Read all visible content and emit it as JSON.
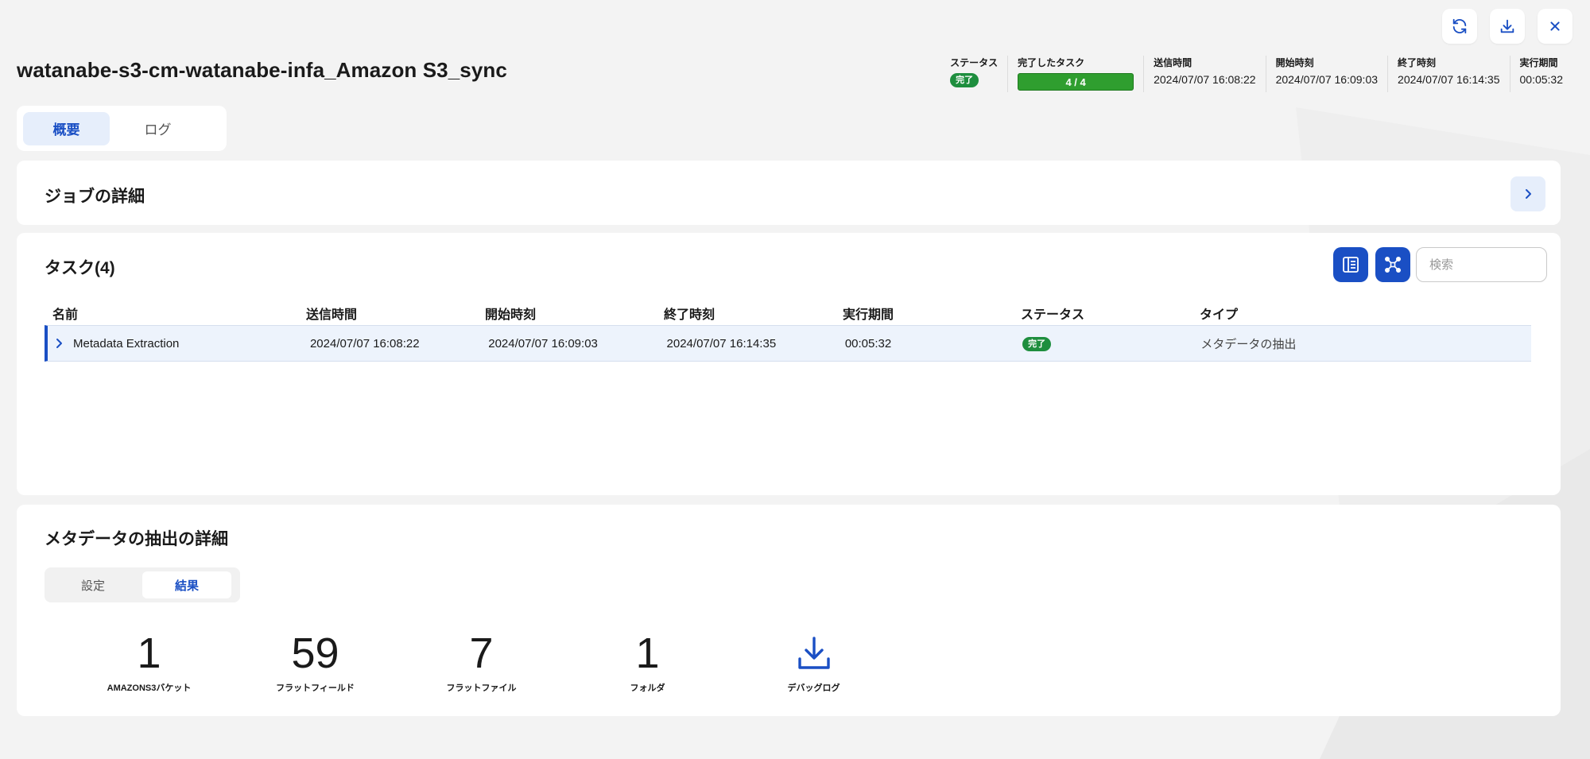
{
  "header": {
    "job_title": "watanabe-s3-cm-watanabe-infa_Amazon S3_sync"
  },
  "actions": {
    "refresh_icon": "refresh-icon",
    "download_icon": "download-icon",
    "close_icon": "close-icon"
  },
  "summary": {
    "status_label": "ステータス",
    "status_value": "完了",
    "tasks_label": "完了したタスク",
    "tasks_value": "4 / 4",
    "tasks_progress": 1.0,
    "submitted_label": "送信時間",
    "submitted_value": "2024/07/07 16:08:22",
    "start_label": "開始時刻",
    "start_value": "2024/07/07 16:09:03",
    "end_label": "終了時刻",
    "end_value": "2024/07/07 16:14:35",
    "duration_label": "実行期間",
    "duration_value": "00:05:32"
  },
  "main_tabs": [
    {
      "label": "概要",
      "active": true
    },
    {
      "label": "ログ",
      "active": false
    }
  ],
  "job_details": {
    "title": "ジョブの詳細"
  },
  "tasks": {
    "title": "タスク(4)",
    "search_placeholder": "検索",
    "columns": [
      "名前",
      "送信時間",
      "開始時刻",
      "終了時刻",
      "実行期間",
      "ステータス",
      "タイプ"
    ],
    "rows": [
      {
        "name": "Metadata Extraction",
        "submitted": "2024/07/07 16:08:22",
        "start": "2024/07/07 16:09:03",
        "end": "2024/07/07 16:14:35",
        "duration": "00:05:32",
        "status": "完了",
        "type": "メタデータの抽出"
      }
    ]
  },
  "extraction": {
    "title": "メタデータの抽出の詳細",
    "tabs": [
      {
        "label": "設定",
        "active": false
      },
      {
        "label": "結果",
        "active": true
      }
    ],
    "stats": [
      {
        "value": "1",
        "label": "AMAZONS3バケット"
      },
      {
        "value": "59",
        "label": "フラットフィールド"
      },
      {
        "value": "7",
        "label": "フラットファイル"
      },
      {
        "value": "1",
        "label": "フォルダ"
      }
    ],
    "debug_log_label": "デバッグログ"
  },
  "colors": {
    "accent": "#1a4fc4",
    "success": "#1e8e3e",
    "background": "#f3f3f3"
  }
}
